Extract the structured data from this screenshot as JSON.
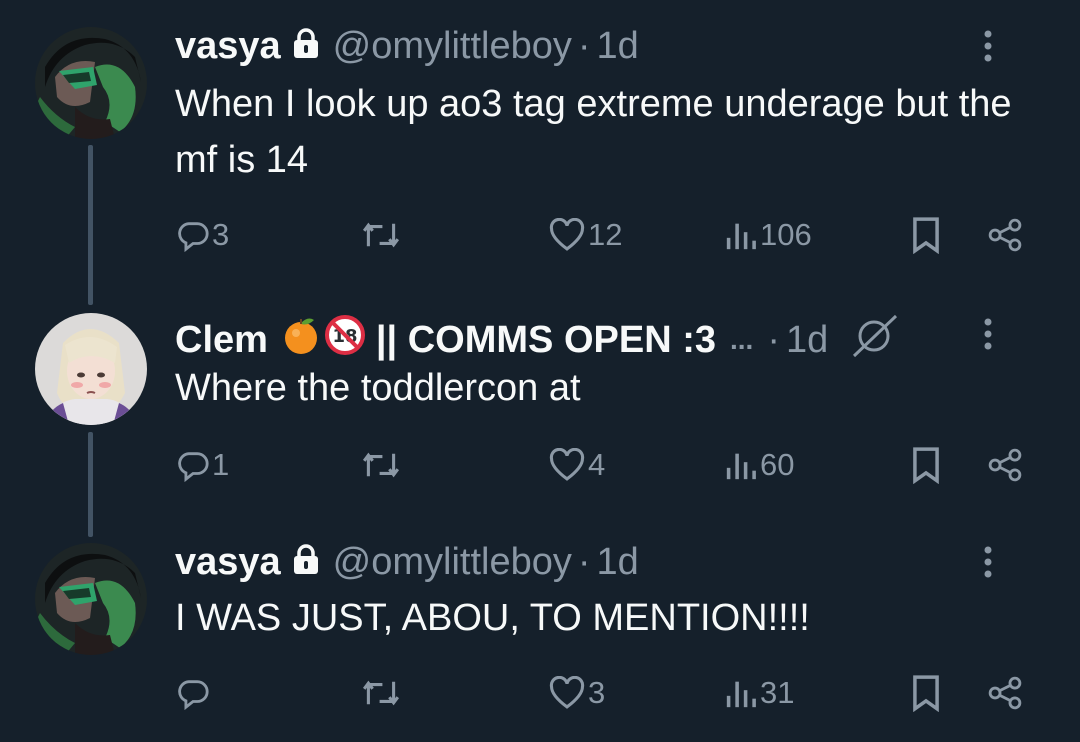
{
  "colors": {
    "background": "#15202b",
    "text": "#f7f9f9",
    "muted": "#8b98a5",
    "thread_line": "#425364"
  },
  "tweets": [
    {
      "name": "vasya",
      "handle": "@omylittleboy",
      "separator": "·",
      "time": "1d",
      "text": "When I look up ao3 tag extreme underage but the mf is 14",
      "replies": "3",
      "retweets": "",
      "likes": "12",
      "views": "106",
      "icons": [
        "lock-icon",
        "more-icon",
        "reply-icon",
        "retweet-icon",
        "like-icon",
        "views-icon",
        "bookmark-icon",
        "share-icon"
      ]
    },
    {
      "name": "Clem",
      "name_suffix": "|| COMMS OPEN :3",
      "ellipsis": "...",
      "separator": "·",
      "time": "1d",
      "text": "Where the toddlercon at",
      "replies": "1",
      "retweets": "",
      "likes": "4",
      "views": "60",
      "icons": [
        "tangerine-emoji-icon",
        "no-under-18-emoji-icon",
        "edited-slash-icon",
        "more-icon"
      ]
    },
    {
      "name": "vasya",
      "handle": "@omylittleboy",
      "separator": "·",
      "time": "1d",
      "text": "I WAS JUST, ABOU, TO MENTION!!!!",
      "replies": "",
      "retweets": "",
      "likes": "3",
      "views": "31",
      "icons": [
        "lock-icon",
        "more-icon"
      ]
    }
  ]
}
